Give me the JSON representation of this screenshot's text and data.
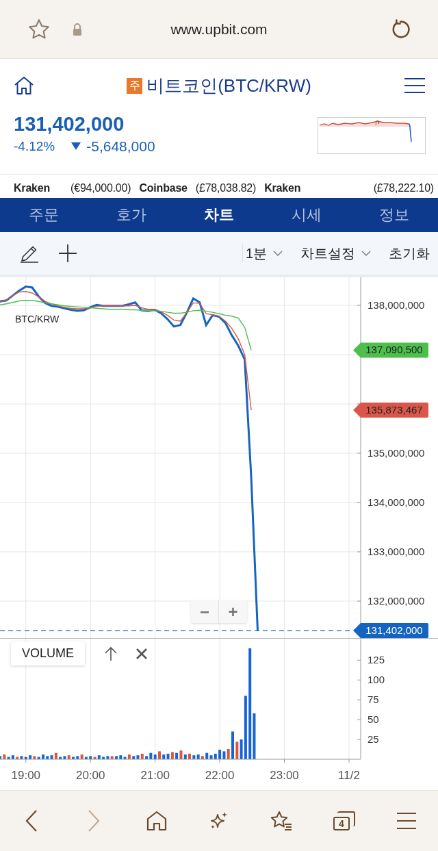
{
  "browser_bar": {
    "url": "www.upbit.com"
  },
  "header": {
    "badge": "주",
    "title": "비트코인(BTC/KRW)"
  },
  "price": {
    "value": "131,402,000",
    "change_rate": "-4.12%",
    "change_amount": "-5,648,000"
  },
  "exchanges": [
    {
      "name": "Kraken",
      "price": "(€94,000.00)"
    },
    {
      "name": "Coinbase",
      "price": "(£78,038.82)"
    },
    {
      "name": "Kraken",
      "price": "(£78,222.10)"
    }
  ],
  "tabs": [
    {
      "label": "주문",
      "selected": false
    },
    {
      "label": "호가",
      "selected": false
    },
    {
      "label": "차트",
      "selected": true
    },
    {
      "label": "시세",
      "selected": false
    },
    {
      "label": "정보",
      "selected": false
    }
  ],
  "toolbar": {
    "interval": "1분",
    "settings": "차트설정",
    "reset": "초기화"
  },
  "price_chart": {
    "zoom_buttons": [
      "−",
      "+"
    ],
    "chart_data": {
      "type": "line",
      "title": "BTC/KRW",
      "grid": true,
      "ylim": [
        131250000,
        138569000
      ],
      "yticks": [
        {
          "value": 138000000,
          "label": "138,000,000"
        },
        {
          "value": 135000000,
          "label": "135,000,000"
        },
        {
          "value": 134000000,
          "label": "134,000,000"
        },
        {
          "value": 133000000,
          "label": "133,000,000"
        },
        {
          "value": 132000000,
          "label": "132,000,000"
        }
      ],
      "categories": [
        null,
        null,
        null,
        null,
        null,
        null,
        null,
        null,
        null,
        null,
        null,
        null,
        null,
        null,
        null,
        null,
        null,
        null,
        null,
        null,
        null,
        null,
        null,
        null,
        null,
        null,
        null,
        null,
        null,
        null,
        null,
        null,
        null,
        null,
        null,
        null,
        null,
        null,
        null,
        null,
        null,
        null,
        null,
        null,
        null,
        null,
        null,
        null,
        null,
        null,
        null,
        null,
        null,
        null,
        null,
        null,
        null,
        null,
        null,
        null,
        null,
        null,
        null,
        null,
        null,
        null,
        null,
        null
      ],
      "series": [
        {
          "color": "#1565c0",
          "values": [
            138080000,
            138100000,
            138200000,
            138300000,
            138380000,
            138360000,
            138180000,
            138050000,
            137990000,
            137970000,
            137940000,
            137910000,
            137890000,
            137900000,
            137960000,
            138010000,
            137990000,
            137990000,
            137990000,
            137990000,
            138020000,
            138060000,
            137900000,
            137890000,
            137910000,
            137840000,
            137720000,
            137570000,
            137600000,
            137850000,
            138140000,
            138060000,
            137600000,
            137800000,
            137770000,
            137640000,
            137390000,
            137180000,
            136900000,
            134500000,
            131400000,
            null,
            null,
            null,
            null,
            null,
            null,
            null,
            null,
            null,
            null,
            null,
            null,
            null,
            null,
            null,
            null,
            null,
            null,
            null,
            null,
            null,
            null,
            null,
            null,
            null,
            null,
            null
          ]
        },
        {
          "color": "#d9574a",
          "values": [
            138060000,
            138110000,
            138200000,
            138270000,
            138280000,
            138250000,
            138170000,
            138080000,
            138030000,
            137990000,
            137960000,
            137940000,
            137930000,
            137930000,
            137950000,
            137980000,
            137990000,
            137990000,
            137990000,
            137990000,
            137990000,
            138000000,
            137950000,
            137920000,
            137920000,
            137870000,
            137800000,
            137700000,
            137680000,
            137850000,
            138050000,
            138040000,
            137830000,
            137810000,
            137780000,
            137680000,
            137530000,
            137320000,
            137000000,
            135873467,
            null,
            null,
            null,
            null,
            null,
            null,
            null,
            null,
            null,
            null,
            null,
            null,
            null,
            null,
            null,
            null,
            null,
            null,
            null,
            null,
            null,
            null,
            null,
            null,
            null,
            null,
            null,
            null
          ]
        },
        {
          "color": "#4cbf4c",
          "values": [
            138010000,
            138030000,
            138060000,
            138090000,
            138100000,
            138100000,
            138080000,
            138050000,
            138030000,
            138010000,
            137990000,
            137980000,
            137970000,
            137960000,
            137950000,
            137940000,
            137930000,
            137920000,
            137920000,
            137920000,
            137910000,
            137910000,
            137900000,
            137900000,
            137890000,
            137880000,
            137860000,
            137840000,
            137840000,
            137860000,
            137890000,
            137900000,
            137880000,
            137860000,
            137830000,
            137800000,
            137780000,
            137740000,
            137550000,
            137090500,
            null,
            null,
            null,
            null,
            null,
            null,
            null,
            null,
            null,
            null,
            null,
            null,
            null,
            null,
            null,
            null,
            null,
            null,
            null,
            null,
            null,
            null,
            null,
            null,
            null,
            null,
            null,
            null
          ]
        }
      ],
      "ref_lines": [
        {
          "axis": "y",
          "value": 131402000,
          "label": "131,402,000",
          "color": "#1565c0"
        }
      ]
    },
    "average_tags": [
      {
        "label": "137,090,500"
      },
      {
        "label": "135,873,467"
      }
    ]
  },
  "volume_panel": {
    "label": "VOLUME",
    "chart_data": {
      "type": "bar",
      "stacked": true,
      "grid": true,
      "xlim": [
        18.6,
        24.18
      ],
      "ylim": [
        0,
        152
      ],
      "yticks": [
        25,
        50,
        75,
        100,
        125
      ],
      "xticks": [
        {
          "value": 19,
          "label": "19:00"
        },
        {
          "value": 20,
          "label": "20:00"
        },
        {
          "value": 21,
          "label": "21:00"
        },
        {
          "value": 22,
          "label": "22:00"
        },
        {
          "value": 23,
          "label": "23:00"
        },
        {
          "value": 24,
          "label": "11/2"
        }
      ],
      "x": [
        18.6,
        18.667,
        18.733,
        18.8,
        18.867,
        18.933,
        19,
        19.067,
        19.133,
        19.2,
        19.267,
        19.333,
        19.4,
        19.467,
        19.533,
        19.6,
        19.667,
        19.733,
        19.8,
        19.867,
        19.933,
        20,
        20.067,
        20.133,
        20.2,
        20.267,
        20.333,
        20.4,
        20.467,
        20.533,
        20.6,
        20.667,
        20.733,
        20.8,
        20.867,
        20.933,
        21,
        21.067,
        21.133,
        21.2,
        21.267,
        21.333,
        21.4,
        21.467,
        21.533,
        21.6,
        21.667,
        21.733,
        21.8,
        21.867,
        21.933,
        22,
        22.067,
        22.133,
        22.2,
        22.267,
        22.333,
        22.4,
        22.467,
        22.533
      ],
      "series": [
        {
          "color": "#d9573a",
          "values": [
            null,
            6,
            null,
            null,
            3,
            null,
            null,
            null,
            4,
            null,
            null,
            null,
            null,
            8,
            null,
            null,
            5,
            null,
            null,
            6,
            null,
            null,
            3,
            null,
            null,
            null,
            4,
            null,
            null,
            null,
            6,
            null,
            null,
            7,
            null,
            null,
            null,
            10,
            null,
            null,
            9,
            null,
            11,
            null,
            7,
            null,
            null,
            4,
            null,
            null,
            null,
            null,
            null,
            13,
            null,
            22,
            null,
            null,
            null,
            null
          ]
        },
        {
          "color": "#1565d8",
          "values": [
            4,
            null,
            3,
            5,
            null,
            4,
            3,
            5,
            null,
            3,
            6,
            4,
            5,
            null,
            3,
            4,
            null,
            3,
            4,
            null,
            3,
            4,
            null,
            5,
            3,
            4,
            null,
            4,
            5,
            3,
            null,
            4,
            5,
            null,
            4,
            8,
            6,
            null,
            6,
            7,
            null,
            8,
            null,
            6,
            null,
            5,
            6,
            null,
            8,
            5,
            7,
            12,
            10,
            null,
            35,
            null,
            25,
            80,
            140,
            58
          ]
        }
      ]
    }
  },
  "bottom_nav": {
    "tab_count": "4",
    "items": [
      {
        "kind": "back",
        "disabled": false
      },
      {
        "kind": "forward",
        "disabled": true
      },
      {
        "kind": "home",
        "disabled": false
      },
      {
        "kind": "sparkle",
        "disabled": false
      },
      {
        "kind": "bookmarks",
        "disabled": false
      },
      {
        "kind": "tabs",
        "disabled": false
      },
      {
        "kind": "menu",
        "disabled": false
      }
    ]
  }
}
